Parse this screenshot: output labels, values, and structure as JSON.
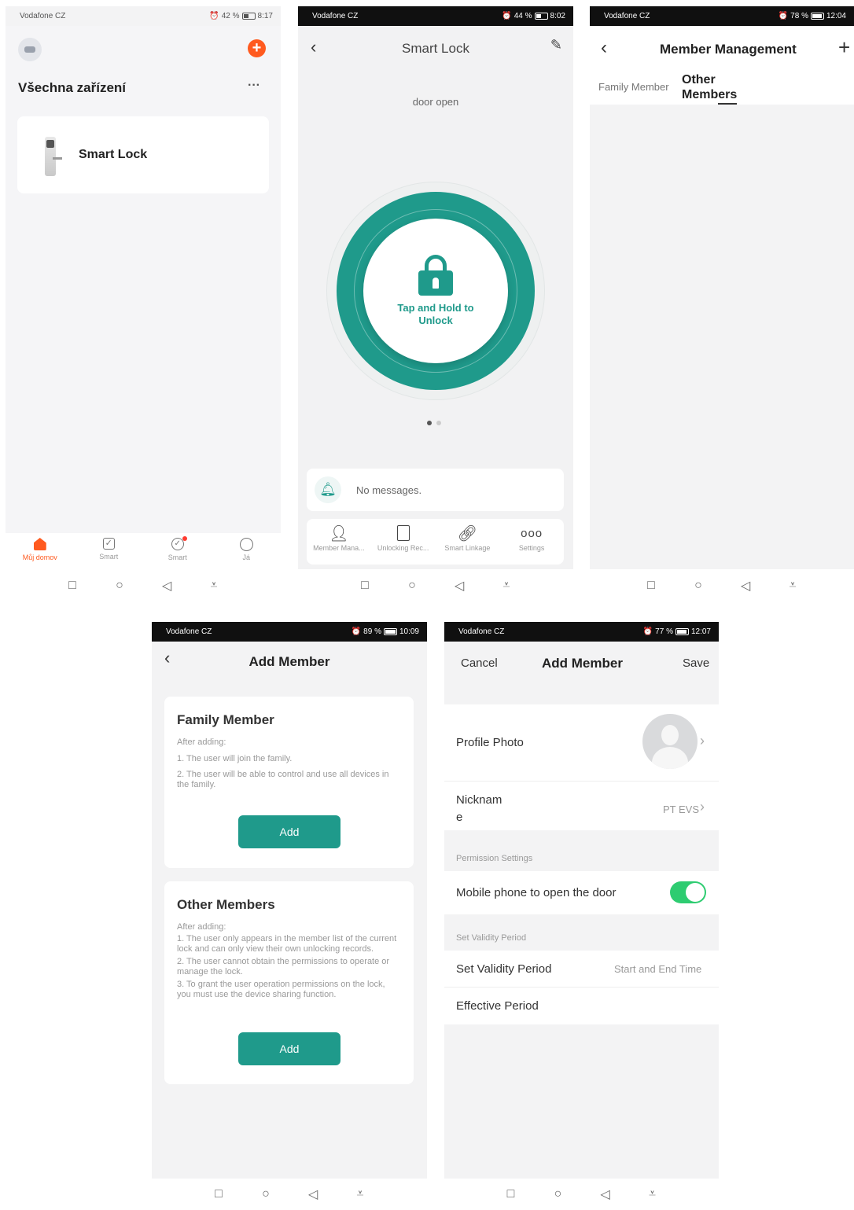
{
  "screen1": {
    "status": {
      "carrier": "Vodafone CZ",
      "battery": "42 %",
      "time": "8:17"
    },
    "section_title": "Všechna zařízení",
    "more": "···",
    "add_icon": "+",
    "device_name": "Smart Lock",
    "tabs": [
      {
        "label": "Můj domov",
        "icon": "home-icon"
      },
      {
        "label": "Smart",
        "icon": "checkbox-icon"
      },
      {
        "label": "Smart",
        "icon": "scene-icon"
      },
      {
        "label": "Já",
        "icon": "profile-icon"
      }
    ],
    "colors": {
      "accent": "#ff5a1f"
    }
  },
  "screen2": {
    "status": {
      "carrier": "Vodafone CZ",
      "battery": "44 %",
      "time": "8:02"
    },
    "title": "Smart Lock",
    "state": "door open",
    "unlock_text": "Tap and Hold to Unlock",
    "messages": "No messages.",
    "actions": [
      {
        "label": "Member Mana...",
        "icon": "person-icon"
      },
      {
        "label": "Unlocking Rec...",
        "icon": "document-icon"
      },
      {
        "label": "Smart Linkage",
        "icon": "link-icon"
      },
      {
        "label": "Settings",
        "icon": "dots-icon"
      }
    ],
    "colors": {
      "ring": "#1f9a8b"
    }
  },
  "screen3": {
    "status": {
      "carrier": "Vodafone CZ",
      "battery": "78 %",
      "time": "12:04"
    },
    "title": "Member Management",
    "tabs": [
      "Family Member",
      "Other Members"
    ]
  },
  "screen4": {
    "status": {
      "carrier": "Vodafone CZ",
      "battery": "89 %",
      "time": "10:09"
    },
    "title": "Add Member",
    "family": {
      "title": "Family Member",
      "after": "After adding:",
      "lines": [
        "1. The user will join the family.",
        "2. The user will be able to control and use all devices in the family."
      ],
      "button": "Add"
    },
    "other": {
      "title": "Other Members",
      "after": "After adding:",
      "lines": [
        "1. The user only appears in the member list of the current lock and can only view their own unlocking records.",
        "2. The user cannot obtain the permissions to operate or manage the lock.",
        "3. To grant the user operation permissions on the lock, you must use the device sharing function."
      ],
      "button": "Add"
    }
  },
  "screen5": {
    "status": {
      "carrier": "Vodafone CZ",
      "battery": "77 %",
      "time": "12:07"
    },
    "cancel": "Cancel",
    "title": "Add Member",
    "save": "Save",
    "profile_photo": "Profile Photo",
    "nickname_label": "Nickname",
    "nickname_value": "PT EVS",
    "permission_header": "Permission Settings",
    "mobile_open": "Mobile phone to open the door",
    "mobile_open_enabled": true,
    "validity_header": "Set Validity Period",
    "validity_label": "Set Validity Period",
    "validity_value": "Start and End Time",
    "effective_label": "Effective Period"
  }
}
